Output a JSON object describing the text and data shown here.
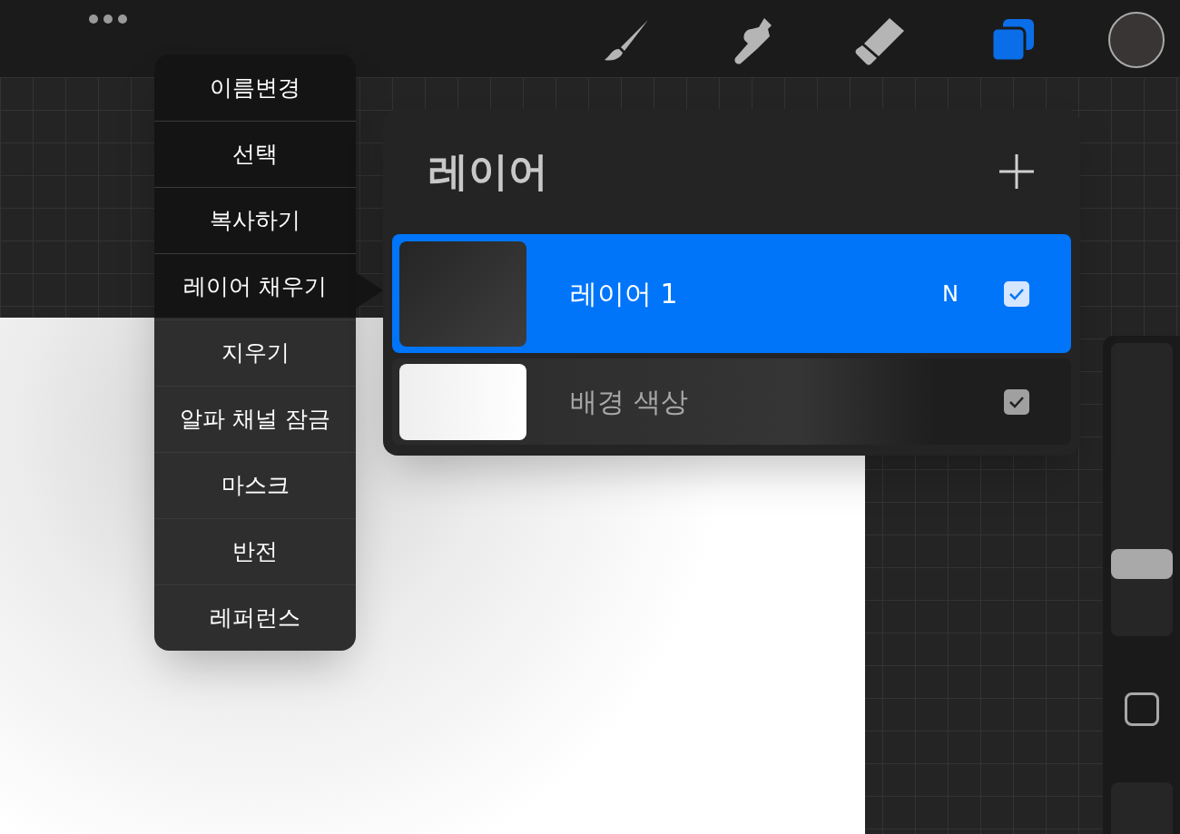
{
  "toolbar": {
    "tools": [
      {
        "kind": "brush",
        "selected": false
      },
      {
        "kind": "smudge",
        "selected": false
      },
      {
        "kind": "eraser",
        "selected": false
      },
      {
        "kind": "layers",
        "selected": true
      }
    ]
  },
  "layer_menu": {
    "items": [
      "이름변경",
      "선택",
      "복사하기",
      "레이어 채우기",
      "지우기",
      "알파 채널 잠금",
      "마스크",
      "반전",
      "레퍼런스"
    ]
  },
  "layers_panel": {
    "title": "레이어",
    "layers": [
      {
        "name": "레이어 1",
        "blend_mode": "N",
        "visible": true,
        "selected": true,
        "kind": "dark"
      },
      {
        "name": "배경 색상",
        "visible": true,
        "selected": false,
        "kind": "white"
      }
    ]
  },
  "sidebar": {
    "size_slider": {
      "level": 0.26
    }
  }
}
